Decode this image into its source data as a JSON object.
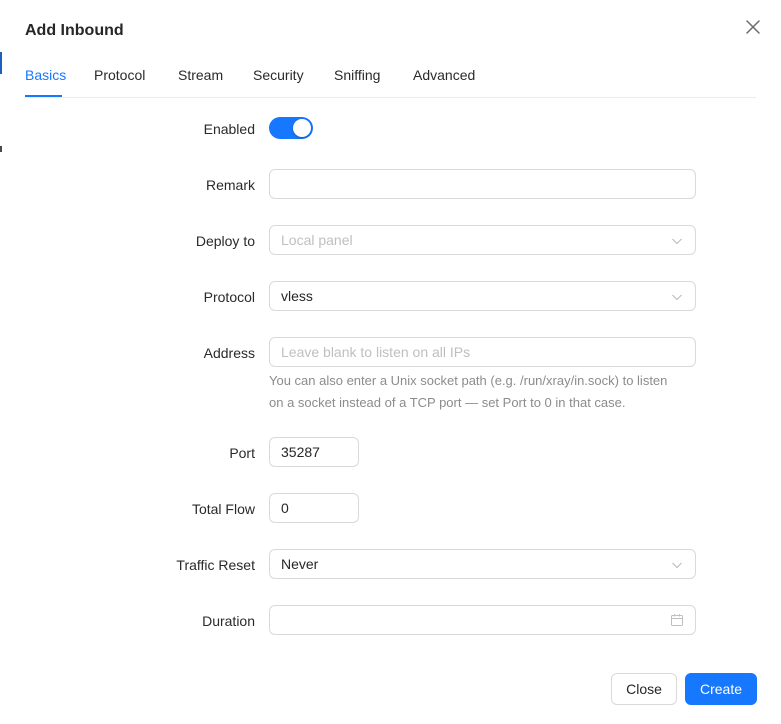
{
  "dialog": {
    "title": "Add Inbound"
  },
  "tabs": [
    {
      "label": "Basics",
      "active": true
    },
    {
      "label": "Protocol",
      "active": false
    },
    {
      "label": "Stream",
      "active": false
    },
    {
      "label": "Security",
      "active": false
    },
    {
      "label": "Sniffing",
      "active": false
    },
    {
      "label": "Advanced",
      "active": false
    }
  ],
  "form": {
    "enabled": {
      "label": "Enabled",
      "value": true
    },
    "remark": {
      "label": "Remark",
      "value": ""
    },
    "deploy_to": {
      "label": "Deploy to",
      "placeholder": "Local panel"
    },
    "protocol": {
      "label": "Protocol",
      "value": "vless"
    },
    "address": {
      "label": "Address",
      "placeholder": "Leave blank to listen on all IPs",
      "hint_line1": "You can also enter a Unix socket path (e.g. /run/xray/in.sock) to listen",
      "hint_line2": "on a socket instead of a TCP port — set Port to 0 in that case."
    },
    "port": {
      "label": "Port",
      "value": "35287"
    },
    "total_flow": {
      "label": "Total Flow",
      "value": "0"
    },
    "traffic_reset": {
      "label": "Traffic Reset",
      "value": "Never"
    },
    "duration": {
      "label": "Duration",
      "value": ""
    }
  },
  "footer": {
    "close_label": "Close",
    "create_label": "Create"
  },
  "colors": {
    "accent": "#1677ff",
    "border": "#d9d9d9",
    "placeholder": "#bfbfbf",
    "hint": "#8c8c8c"
  },
  "icons": {
    "close": "close-icon",
    "dropdown": "chevron-down-icon",
    "date": "calendar-icon"
  }
}
